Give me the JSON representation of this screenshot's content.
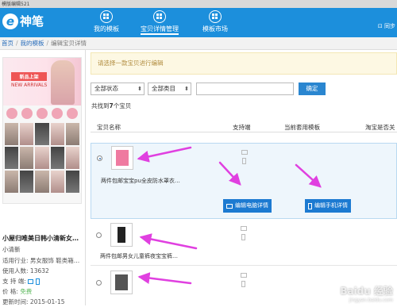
{
  "window": {
    "title": "模版编辑521"
  },
  "header": {
    "logo_text": "神笔",
    "nav": [
      {
        "label": "我的模板",
        "icon": "template-icon"
      },
      {
        "label": "宝贝详情管理",
        "icon": "details-icon"
      },
      {
        "label": "模板市场",
        "icon": "market-icon"
      }
    ],
    "sync_label": "同步"
  },
  "breadcrumb": {
    "items": [
      "首页",
      "我的模板",
      "编辑宝贝详情"
    ]
  },
  "sidebar": {
    "banner_tag": "新品上架",
    "banner_subtitle": "NEW ARRIVALS",
    "shop_title": "小屋归唯美日韩小清新女…",
    "shop_author": "小清新",
    "info": [
      {
        "label": "适用行业:",
        "value": "男女服饰 鞋类箱…"
      },
      {
        "label": "使用人数:",
        "value": "13632"
      },
      {
        "label": "支 持 端:",
        "value": ""
      },
      {
        "label": "价    格:",
        "value": "免费"
      },
      {
        "label": "更新时间:",
        "value": "2015-01-15"
      }
    ]
  },
  "main": {
    "notice": "请选择一款宝贝进行编辑",
    "filters": {
      "status": "全部状态",
      "category": "全部类目",
      "search_placeholder": "",
      "confirm": "确定"
    },
    "count_prefix": "共找到",
    "count_value": "7",
    "count_suffix": "个宝贝",
    "columns": [
      "宝贝名称",
      "支持端",
      "当前套用模板",
      "淘宝是否关"
    ],
    "rows": [
      {
        "name": "两件包邮宝宝pu全皮防水罩衣…",
        "selected": true,
        "color": "#ef7aa0"
      },
      {
        "name": "两件包邮男女儿童裤夜宝宝裤…",
        "selected": false,
        "color": "#222222"
      },
      {
        "name": "",
        "selected": false,
        "color": "#555555"
      }
    ],
    "edit_pc": "编辑电脑详情",
    "edit_mobile": "编辑手机详情"
  },
  "watermark": {
    "brand": "Baidu 经验",
    "url": "jingyan.baidu.com"
  },
  "colors": {
    "brand": "#1c8fdc",
    "arrow": "#e040e0",
    "button": "#1c7ad1"
  }
}
